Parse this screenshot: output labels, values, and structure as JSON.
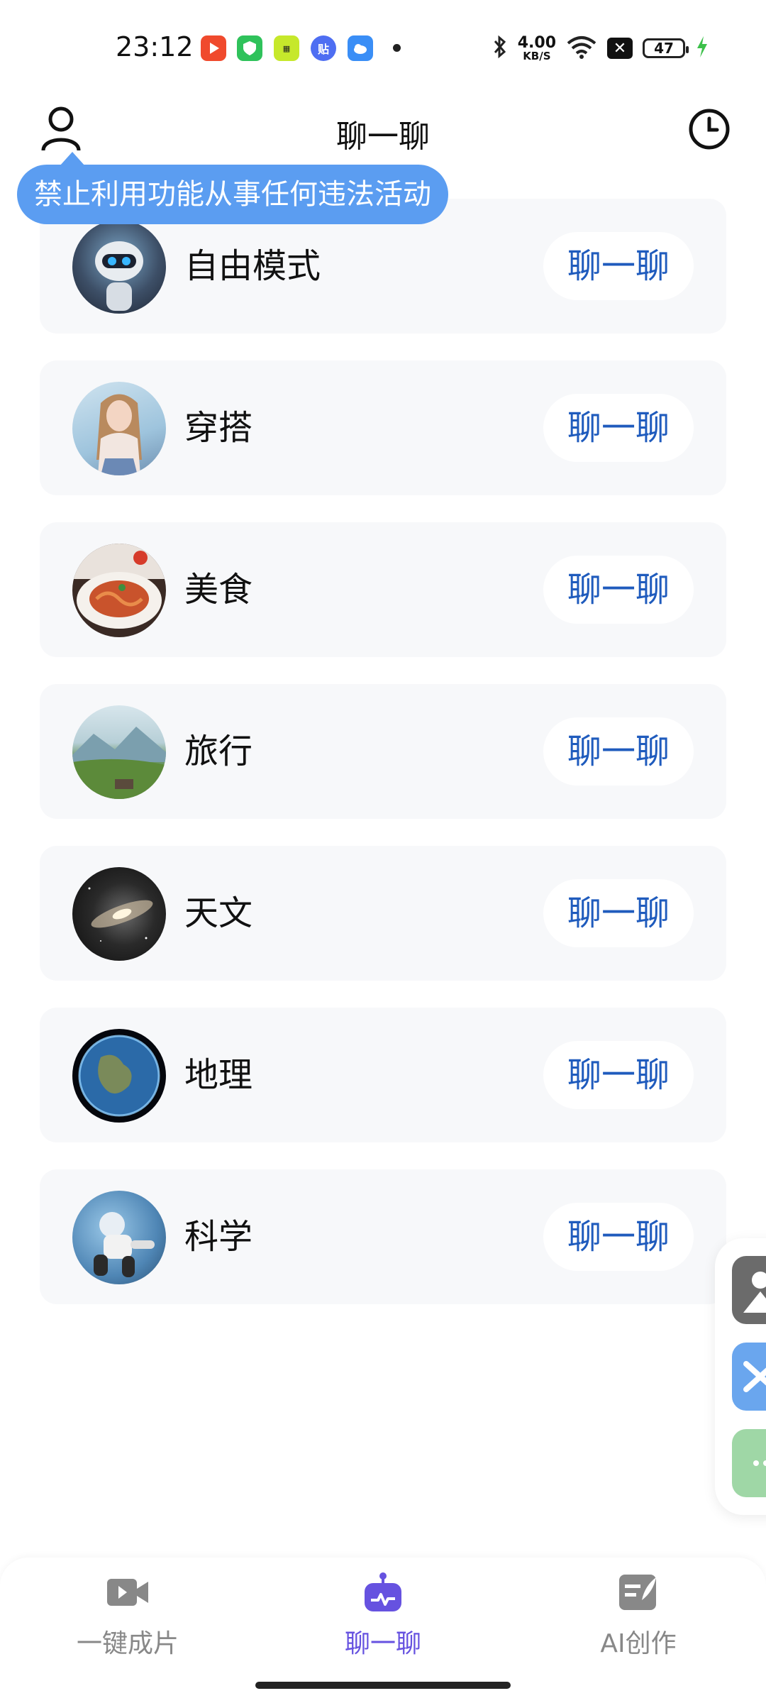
{
  "status_bar": {
    "time": "23:12",
    "network_speed": "4.00",
    "speed_unit": "KB/S",
    "battery": "47",
    "icons": [
      "video-app-icon",
      "shield-app-icon",
      "news-app-icon",
      "tieba-app-icon",
      "weather-app-icon",
      "bluetooth-icon",
      "wifi-icon",
      "close-box-icon",
      "battery-icon",
      "charging-icon"
    ]
  },
  "header": {
    "title": "聊一聊",
    "left_icon": "user-icon",
    "right_icon": "history-clock-icon"
  },
  "tooltip": {
    "text": "禁止利用功能从事任何违法活动"
  },
  "cards": [
    {
      "title": "自由模式",
      "button": "聊一聊",
      "avatar": "robot-avatar"
    },
    {
      "title": "穿搭",
      "button": "聊一聊",
      "avatar": "fashion-avatar"
    },
    {
      "title": "美食",
      "button": "聊一聊",
      "avatar": "food-avatar"
    },
    {
      "title": "旅行",
      "button": "聊一聊",
      "avatar": "travel-avatar"
    },
    {
      "title": "天文",
      "button": "聊一聊",
      "avatar": "galaxy-avatar"
    },
    {
      "title": "地理",
      "button": "聊一聊",
      "avatar": "earth-avatar"
    },
    {
      "title": "科学",
      "button": "聊一聊",
      "avatar": "astronaut-avatar"
    }
  ],
  "bottom_nav": {
    "items": [
      {
        "label": "一键成片",
        "icon": "video-camera-icon",
        "active": false
      },
      {
        "label": "聊一聊",
        "icon": "robot-icon",
        "active": true
      },
      {
        "label": "AI创作",
        "icon": "write-icon",
        "active": false
      }
    ]
  },
  "colors": {
    "accent": "#6652e0",
    "button_text": "#1f5bbd",
    "tooltip_bg": "#5b9df1",
    "card_bg": "#f7f8fa"
  }
}
